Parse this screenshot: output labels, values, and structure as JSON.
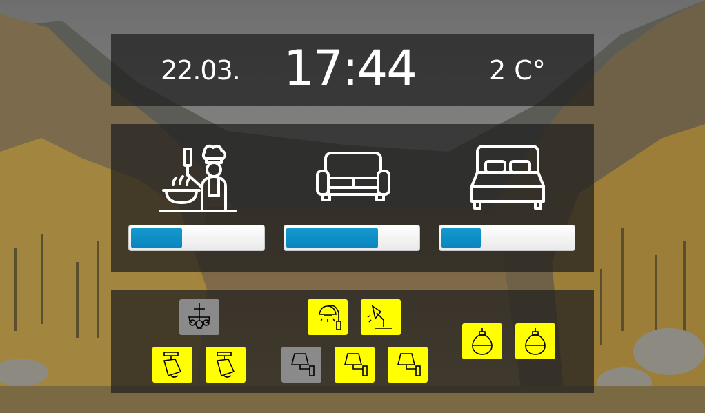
{
  "header": {
    "date": "22.03.",
    "time": "17:44",
    "temperature": "2 C°"
  },
  "rooms": [
    {
      "icon": "chef-cooking-icon",
      "progress_percent": 39
    },
    {
      "icon": "sofa-icon",
      "progress_percent": 70
    },
    {
      "icon": "bed-icon",
      "progress_percent": 30
    }
  ],
  "lights": [
    {
      "icon": "chandelier-icon",
      "state": "off"
    },
    {
      "icon": "ceiling-spotlight-icon",
      "state": "on"
    },
    {
      "icon": "ceiling-spotlight-icon",
      "state": "on"
    },
    {
      "icon": "wall-lamp-icon",
      "state": "on"
    },
    {
      "icon": "desk-lamp-icon",
      "state": "on"
    },
    {
      "icon": "wall-sconce-icon",
      "state": "off"
    },
    {
      "icon": "wall-sconce-icon",
      "state": "on"
    },
    {
      "icon": "wall-sconce-icon",
      "state": "on"
    },
    {
      "icon": "pendant-bulb-icon",
      "state": "on"
    },
    {
      "icon": "pendant-bulb-icon",
      "state": "on"
    }
  ],
  "colors": {
    "light_on": "#ffff00",
    "light_off": "#8a8a8a",
    "progress_fill": "#0a8fc6",
    "panel": "rgba(30,30,30,0.72)"
  }
}
